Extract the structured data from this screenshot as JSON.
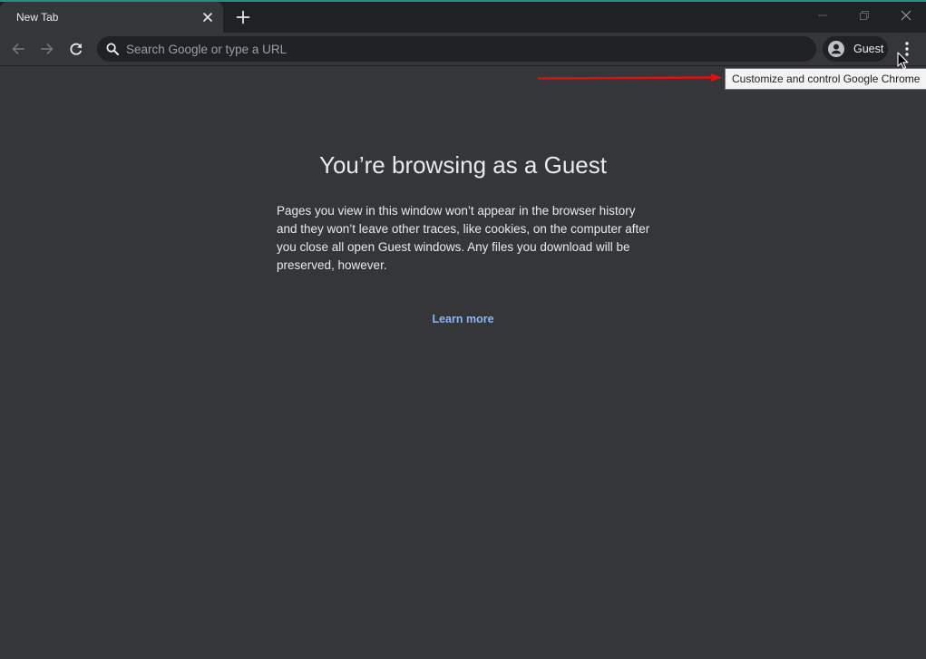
{
  "tab": {
    "title": "New Tab"
  },
  "omnibox": {
    "placeholder": "Search Google or type a URL",
    "value": ""
  },
  "profile": {
    "label": "Guest"
  },
  "tooltip": {
    "text": "Customize and control Google Chrome"
  },
  "content": {
    "title": "You’re browsing as a Guest",
    "body": "Pages you view in this window won’t appear in the browser history and they won’t leave other traces, like cookies, on the computer after you close all open Guest windows. Any files you download will be preserved, however.",
    "learn_more": "Learn more"
  },
  "colors": {
    "background": "#35363a",
    "tabstrip": "#202124",
    "accent_line": "#2a8c86",
    "link": "#8ab4f8",
    "annotation_arrow": "#e01010"
  },
  "icons": {
    "tab_close": "close-icon",
    "new_tab": "plus-icon",
    "back": "arrow-left-icon",
    "forward": "arrow-right-icon",
    "reload": "reload-icon",
    "search": "search-icon",
    "profile": "account-circle-icon",
    "menu": "kebab-menu-icon",
    "minimize": "minimize-icon",
    "restore": "restore-icon",
    "close_window": "close-icon"
  }
}
